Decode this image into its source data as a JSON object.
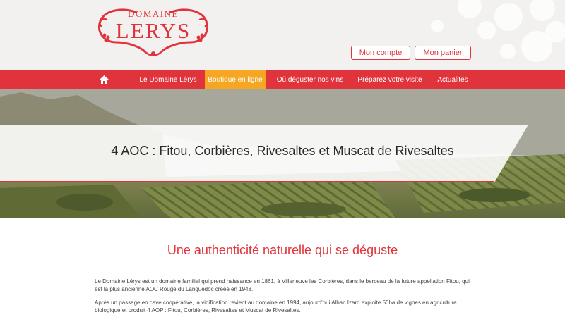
{
  "logo": {
    "top": "DOMAINE",
    "main": "LERYS"
  },
  "account": {
    "my_account": "Mon compte",
    "my_cart": "Mon panier"
  },
  "nav": {
    "home_icon": "home-icon",
    "items": [
      {
        "label": "Le Domaine Lérys"
      },
      {
        "label": "Boutique en ligne",
        "active": true
      },
      {
        "label": "Où déguster nos vins"
      },
      {
        "label": "Préparez votre visite"
      },
      {
        "label": "Actualités"
      }
    ]
  },
  "hero": {
    "title": "4 AOC : Fitou, Corbières, Rivesaltes et Muscat de Rivesaltes"
  },
  "content": {
    "heading": "Une authenticité naturelle qui se déguste",
    "paragraphs": [
      "Le Domaine Lérys est un domaine familial qui prend naissance en 1861, à Villeneuve les Corbières, dans le berceau de la future appellation Fitou, qui est la plus ancienne AOC Rouge du Languedoc créée en 1948.",
      "Après un passage en cave coopérative, la vinification revient au domaine en 1994, aujourd'hui Alban Izard exploite 50ha de vignes en agriculture biologique et produit 4 AOP : Fitou, Corbières, Rivesaltes et Muscat de Rivesaltes."
    ]
  },
  "colors": {
    "brand_red": "#e1333b",
    "active_orange": "#f5a623",
    "header_bg": "#f3f1ef"
  }
}
